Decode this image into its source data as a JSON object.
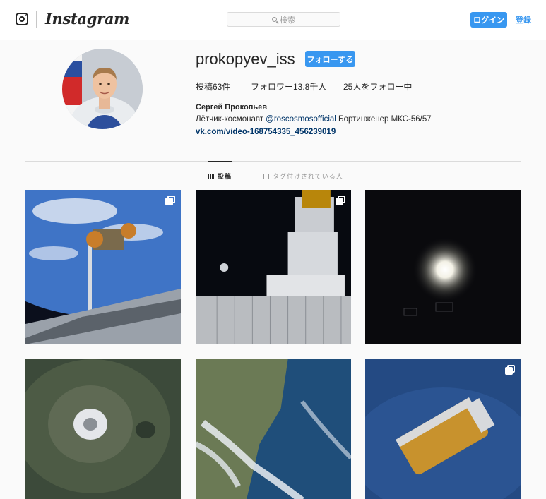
{
  "header": {
    "logo_icon": "instagram-camera-icon",
    "wordmark": "Instagram",
    "search_placeholder": "検索",
    "login_label": "ログイン",
    "signup_label": "登録"
  },
  "profile": {
    "username": "prokopyev_iss",
    "follow_label": "フォローする",
    "stats": {
      "posts": "投稿63件",
      "followers": "フォロワー13.8千人",
      "following": "25人をフォロー中"
    },
    "full_name": "Сергей Прокопьев",
    "bio_prefix": "Лётчик-космонавт ",
    "bio_mention": "@roscosmosofficial",
    "bio_suffix": " Бортинженер МКС-56/57",
    "link": "vk.com/video-168754335_456239019"
  },
  "tabs": [
    {
      "label": "投稿",
      "icon": "grid-icon",
      "active": true
    },
    {
      "label": "タグ付けされている人",
      "icon": "tag-icon",
      "active": false
    }
  ],
  "posts": [
    {
      "subject": "cygnus-capture-over-earth",
      "multiple": true
    },
    {
      "subject": "iss-modules-docked-vehicles",
      "multiple": true
    },
    {
      "subject": "bright-light-in-darkness",
      "multiple": false
    },
    {
      "subject": "snow-capped-volcano",
      "multiple": false
    },
    {
      "subject": "coastline-snow-ice",
      "multiple": false
    },
    {
      "subject": "htv-cargo-ship-over-ocean",
      "multiple": true
    }
  ],
  "colors": {
    "accent": "#3897f0",
    "link": "#003569",
    "text": "#262626",
    "muted": "#999999",
    "border": "#dbdbdb",
    "background": "#fafafa"
  }
}
